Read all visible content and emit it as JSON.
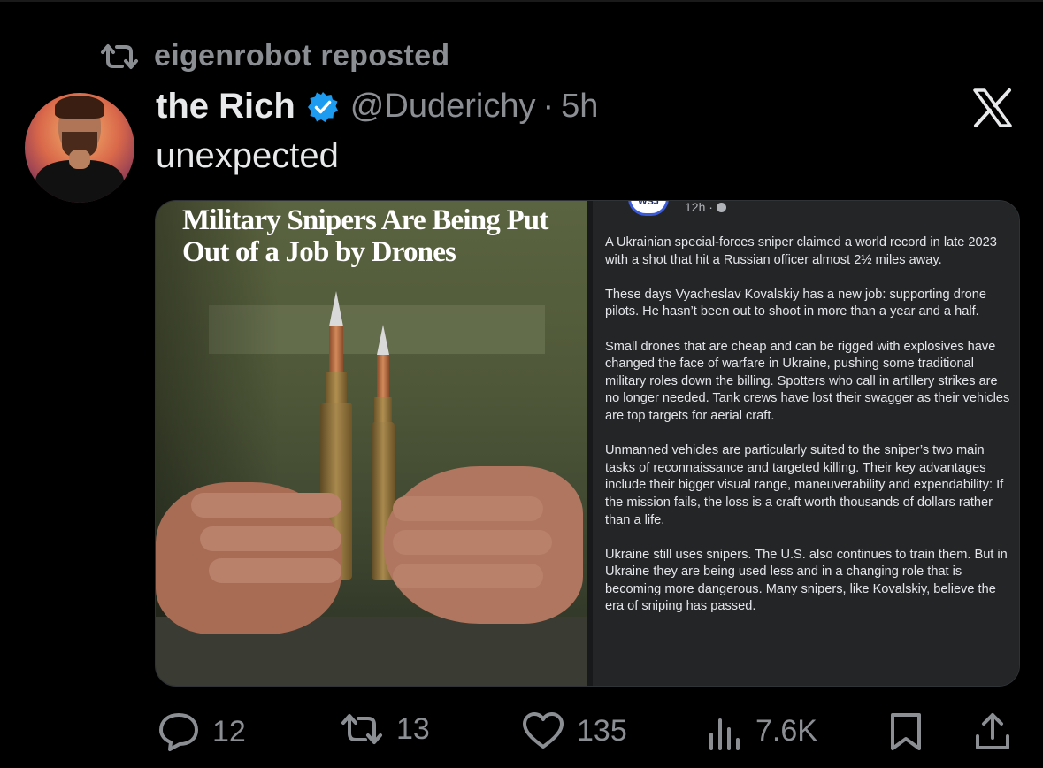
{
  "repost": {
    "label": "eigenrobot reposted"
  },
  "author": {
    "name": "the Rich",
    "handle": "@Duderichy",
    "separator": "·",
    "time": "5h"
  },
  "tweet": {
    "text": "unexpected"
  },
  "media": {
    "headline": "Military Snipers Are Being Put Out of a Job by Drones",
    "source": {
      "badge": "WSJ",
      "time": "12h ·"
    },
    "paragraphs": [
      "A Ukrainian special-forces sniper claimed a world record in late 2023 with a shot that hit a Russian officer almost 2½ miles away.",
      "These days Vyacheslav Kovalskiy has a new job: supporting drone pilots. He hasn’t been out to shoot in more than a year and a half.",
      "Small drones that are cheap and can be rigged with explosives have changed the face of warfare in Ukraine, pushing some traditional military roles down the billing. Spotters who call in artillery strikes are no longer needed. Tank crews have lost their swagger as their vehicles are top targets for aerial craft.",
      "Unmanned vehicles are particularly suited to the sniper’s two main tasks of reconnaissance and targeted killing. Their key advantages include their bigger visual range, maneuverability and expendability: If the mission fails, the loss is a craft worth thousands of dollars rather than a life.",
      "Ukraine still uses snipers. The U.S. also continues to train them. But in Ukraine they are being used less and in a changing role that is becoming more dangerous. Many snipers, like Kovalskiy, believe the era of sniping has passed."
    ]
  },
  "actions": {
    "replies": "12",
    "reposts": "13",
    "likes": "135",
    "views": "7.6K"
  },
  "colors": {
    "background": "#000000",
    "text": "#e7e9ea",
    "muted": "#8b8f94",
    "verified": "#1d9bf0"
  },
  "icons": [
    "repost-icon",
    "verified-badge-icon",
    "x-logo-icon",
    "reply-icon",
    "repost-icon",
    "like-icon",
    "views-icon",
    "bookmark-icon",
    "share-icon"
  ]
}
